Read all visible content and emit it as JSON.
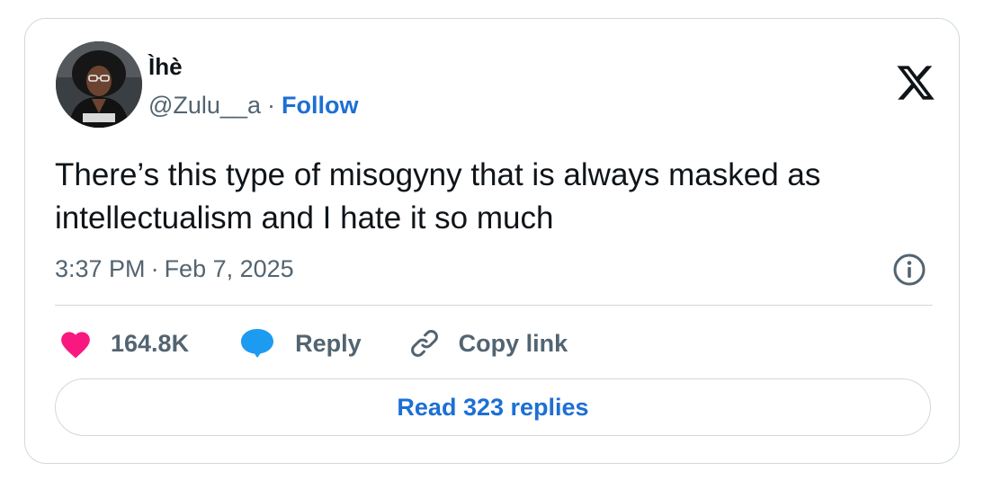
{
  "tweet": {
    "author": {
      "display_name": "Ìhè",
      "handle": "@Zulu__a",
      "separator": "·",
      "follow_label": "Follow"
    },
    "text": "There’s this type of misogyny that is always masked as intellectualism and I hate it so much",
    "time": "3:37 PM",
    "date_separator": "·",
    "date": "Feb 7, 2025",
    "actions": {
      "like_count": "164.8K",
      "reply_label": "Reply",
      "copy_link_label": "Copy link"
    },
    "read_replies_label": "Read 323 replies"
  },
  "icons": {
    "brand": "x-logo-icon",
    "info": "info-icon",
    "like": "heart-icon",
    "reply": "speech-bubble-icon",
    "copy": "link-icon"
  },
  "colors": {
    "heart": "#f91880",
    "reply_bubble": "#1d9bf0",
    "link_blue": "#1d6fd4",
    "secondary_text": "#536471",
    "border": "#cfd9de"
  }
}
